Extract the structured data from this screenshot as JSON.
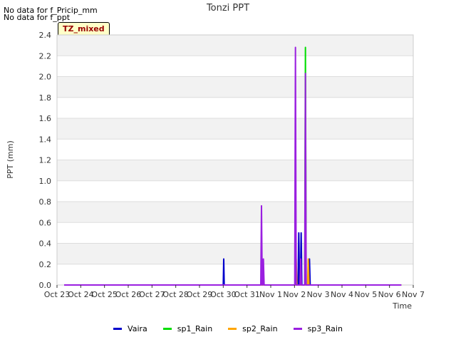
{
  "notices": [
    "No data for f_Pricip_mm",
    "No data for f_ppt"
  ],
  "badge": "TZ_mixed",
  "chart_data": {
    "type": "line",
    "title": "Tonzi PPT",
    "xlabel": "Time",
    "ylabel": "PPT (mm)",
    "x_ticks": [
      "Oct 23",
      "Oct 24",
      "Oct 25",
      "Oct 26",
      "Oct 27",
      "Oct 28",
      "Oct 29",
      "Oct 30",
      "Oct 31",
      "Nov 1",
      "Nov 2",
      "Nov 3",
      "Nov 4",
      "Nov 5",
      "Nov 6",
      "Nov 7"
    ],
    "xlim": [
      0,
      15
    ],
    "ylim": [
      0,
      2.4
    ],
    "y_ticks": [
      0.0,
      0.2,
      0.4,
      0.6,
      0.8,
      1.0,
      1.2,
      1.4,
      1.6,
      1.8,
      2.0,
      2.2,
      2.4
    ],
    "grid": true,
    "legend_position": "bottom",
    "series": [
      {
        "name": "Vaira",
        "color": "#0000cc",
        "points": [
          [
            0.3,
            0
          ],
          [
            7.0,
            0
          ],
          [
            7.02,
            0.25
          ],
          [
            7.04,
            0
          ],
          [
            10.15,
            0
          ],
          [
            10.18,
            0.5
          ],
          [
            10.21,
            0
          ],
          [
            10.25,
            0
          ],
          [
            10.28,
            0.5
          ],
          [
            10.31,
            0
          ],
          [
            10.6,
            0
          ],
          [
            10.63,
            0.25
          ],
          [
            10.66,
            0
          ],
          [
            14.5,
            0
          ]
        ]
      },
      {
        "name": "sp1_Rain",
        "color": "#00dd00",
        "points": [
          [
            0.3,
            0
          ],
          [
            10.43,
            0
          ],
          [
            10.46,
            2.28
          ],
          [
            10.49,
            0
          ],
          [
            14.5,
            0
          ]
        ]
      },
      {
        "name": "sp2_Rain",
        "color": "#ffa500",
        "points": [
          [
            0.3,
            0
          ],
          [
            10.04,
            0
          ],
          [
            10.07,
            0.25
          ],
          [
            10.1,
            0
          ],
          [
            10.55,
            0
          ],
          [
            10.58,
            0.25
          ],
          [
            10.61,
            0
          ],
          [
            14.5,
            0
          ]
        ]
      },
      {
        "name": "sp3_Rain",
        "color": "#9a1fe0",
        "points": [
          [
            0.3,
            0
          ],
          [
            8.58,
            0
          ],
          [
            8.61,
            0.76
          ],
          [
            8.64,
            0
          ],
          [
            8.66,
            0
          ],
          [
            8.69,
            0.25
          ],
          [
            8.72,
            0
          ],
          [
            10.01,
            0
          ],
          [
            10.04,
            2.28
          ],
          [
            10.07,
            0
          ],
          [
            10.23,
            0
          ],
          [
            10.26,
            0.25
          ],
          [
            10.29,
            0
          ],
          [
            10.43,
            0
          ],
          [
            10.46,
            2.03
          ],
          [
            10.49,
            0
          ],
          [
            14.5,
            0
          ]
        ]
      }
    ]
  }
}
